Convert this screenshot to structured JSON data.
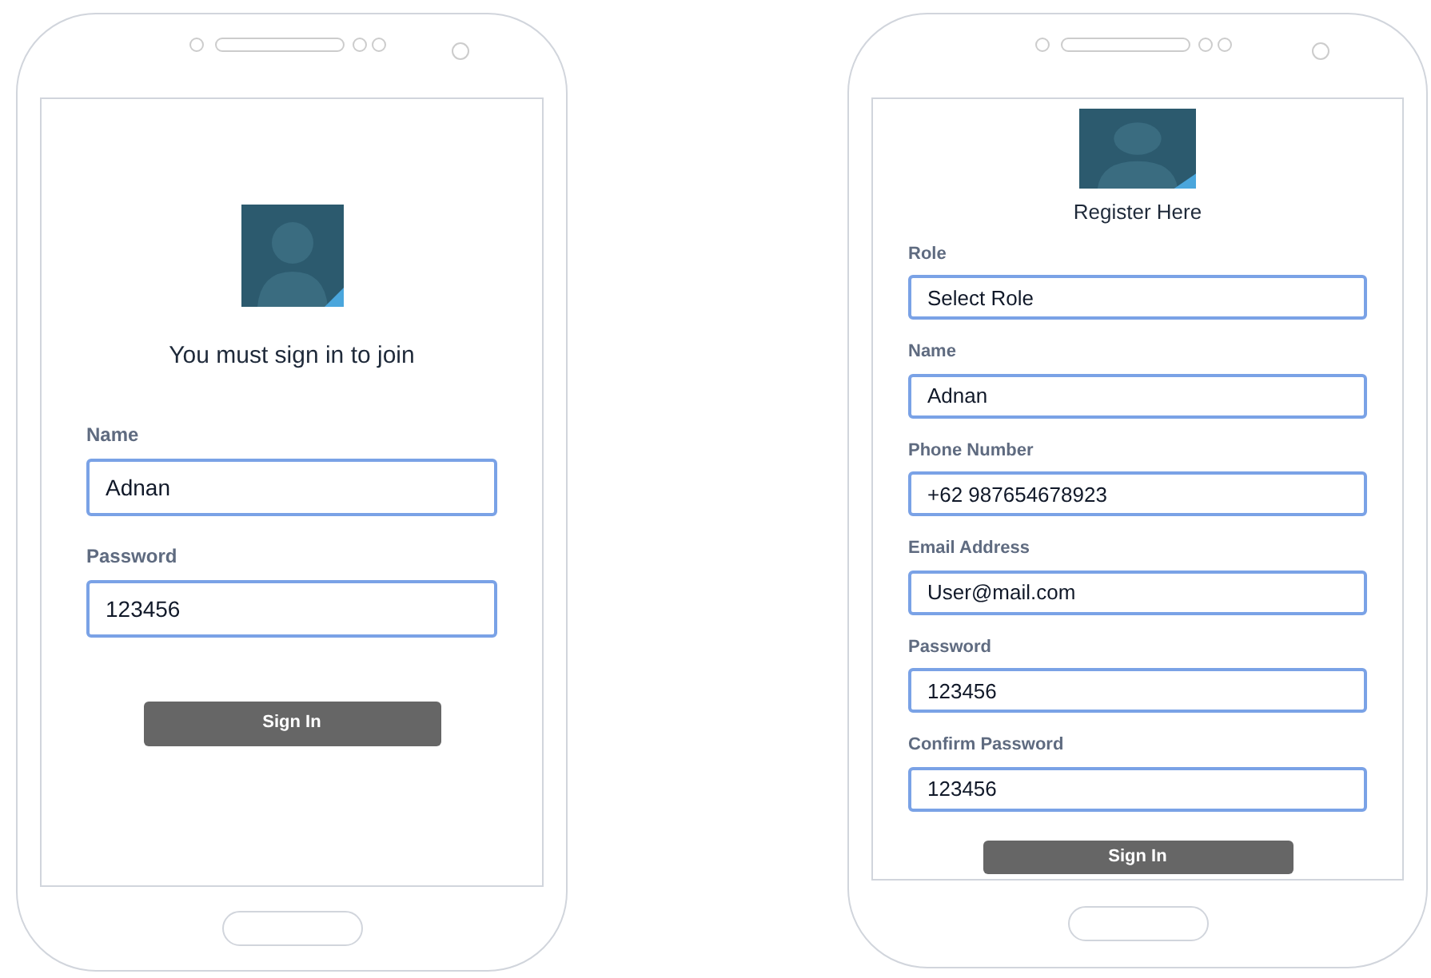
{
  "phones": [
    {
      "kind": "login",
      "title": "You must sign in to join",
      "fields": [
        {
          "label": "Name",
          "value": "Adnan"
        },
        {
          "label": "Password",
          "value": "123456"
        }
      ],
      "button": "Sign In"
    },
    {
      "kind": "register",
      "title": "Register Here",
      "fields": [
        {
          "label": "Role",
          "value": "Select Role"
        },
        {
          "label": "Name",
          "value": "Adnan"
        },
        {
          "label": "Phone Number",
          "value": "+62 987654678923"
        },
        {
          "label": "Email Address",
          "value": "User@mail.com"
        },
        {
          "label": "Password",
          "value": "123456"
        },
        {
          "label": "Confirm Password",
          "value": "123456"
        }
      ],
      "button": "Sign In"
    }
  ]
}
